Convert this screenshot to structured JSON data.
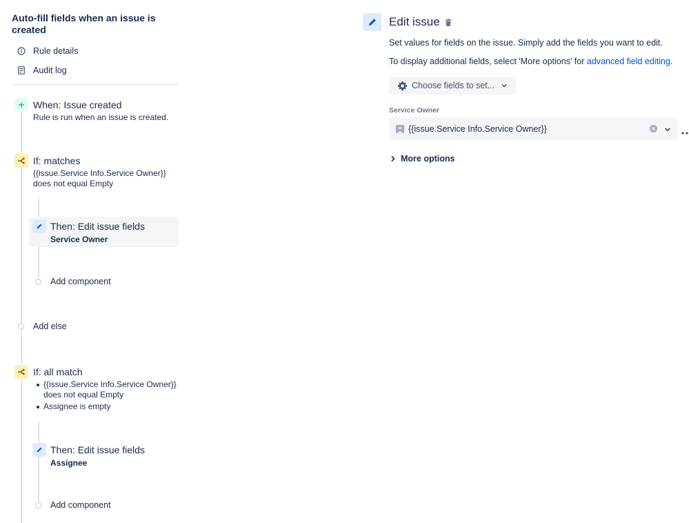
{
  "sidebar": {
    "rule_title": "Auto-fill fields when an issue is created",
    "nav": [
      {
        "label": "Rule details",
        "icon": "info-icon"
      },
      {
        "label": "Audit log",
        "icon": "audit-log-icon"
      }
    ]
  },
  "flow": {
    "trigger": {
      "title": "When: Issue created",
      "subtitle": "Rule is run when an issue is created."
    },
    "condition1": {
      "title": "If: matches",
      "line1": "{{issue.Service Info.Service Owner}}",
      "line2": "does not equal Empty"
    },
    "action1": {
      "title": "Then: Edit issue fields",
      "field": "Service Owner"
    },
    "add_component_1": "Add component",
    "add_else": "Add else",
    "condition2": {
      "title": "If: all match",
      "bullets": [
        {
          "line1": "{{issue.Service Info.Service Owner}}",
          "line2": "does not equal Empty"
        },
        {
          "line1": "Assignee is empty"
        }
      ]
    },
    "action2": {
      "title": "Then: Edit issue fields",
      "field": "Assignee"
    },
    "add_component_2": "Add component"
  },
  "editor": {
    "title": "Edit issue",
    "desc1": "Set values for fields on the issue. Simply add the fields you want to edit.",
    "desc2_prefix": "To display additional fields, select 'More options' for ",
    "desc2_link": "advanced field editing",
    "desc2_suffix": ".",
    "choose_fields_label": "Choose fields to set...",
    "field_label": "Service Owner",
    "field_value": "{{issue.Service Info.Service Owner}}",
    "more_options_label": "More options"
  },
  "colors": {
    "accent": "#0052cc",
    "trigger_bg": "#e3fcef",
    "condition_bg": "#fff0b3",
    "action_bg": "#deebff"
  }
}
